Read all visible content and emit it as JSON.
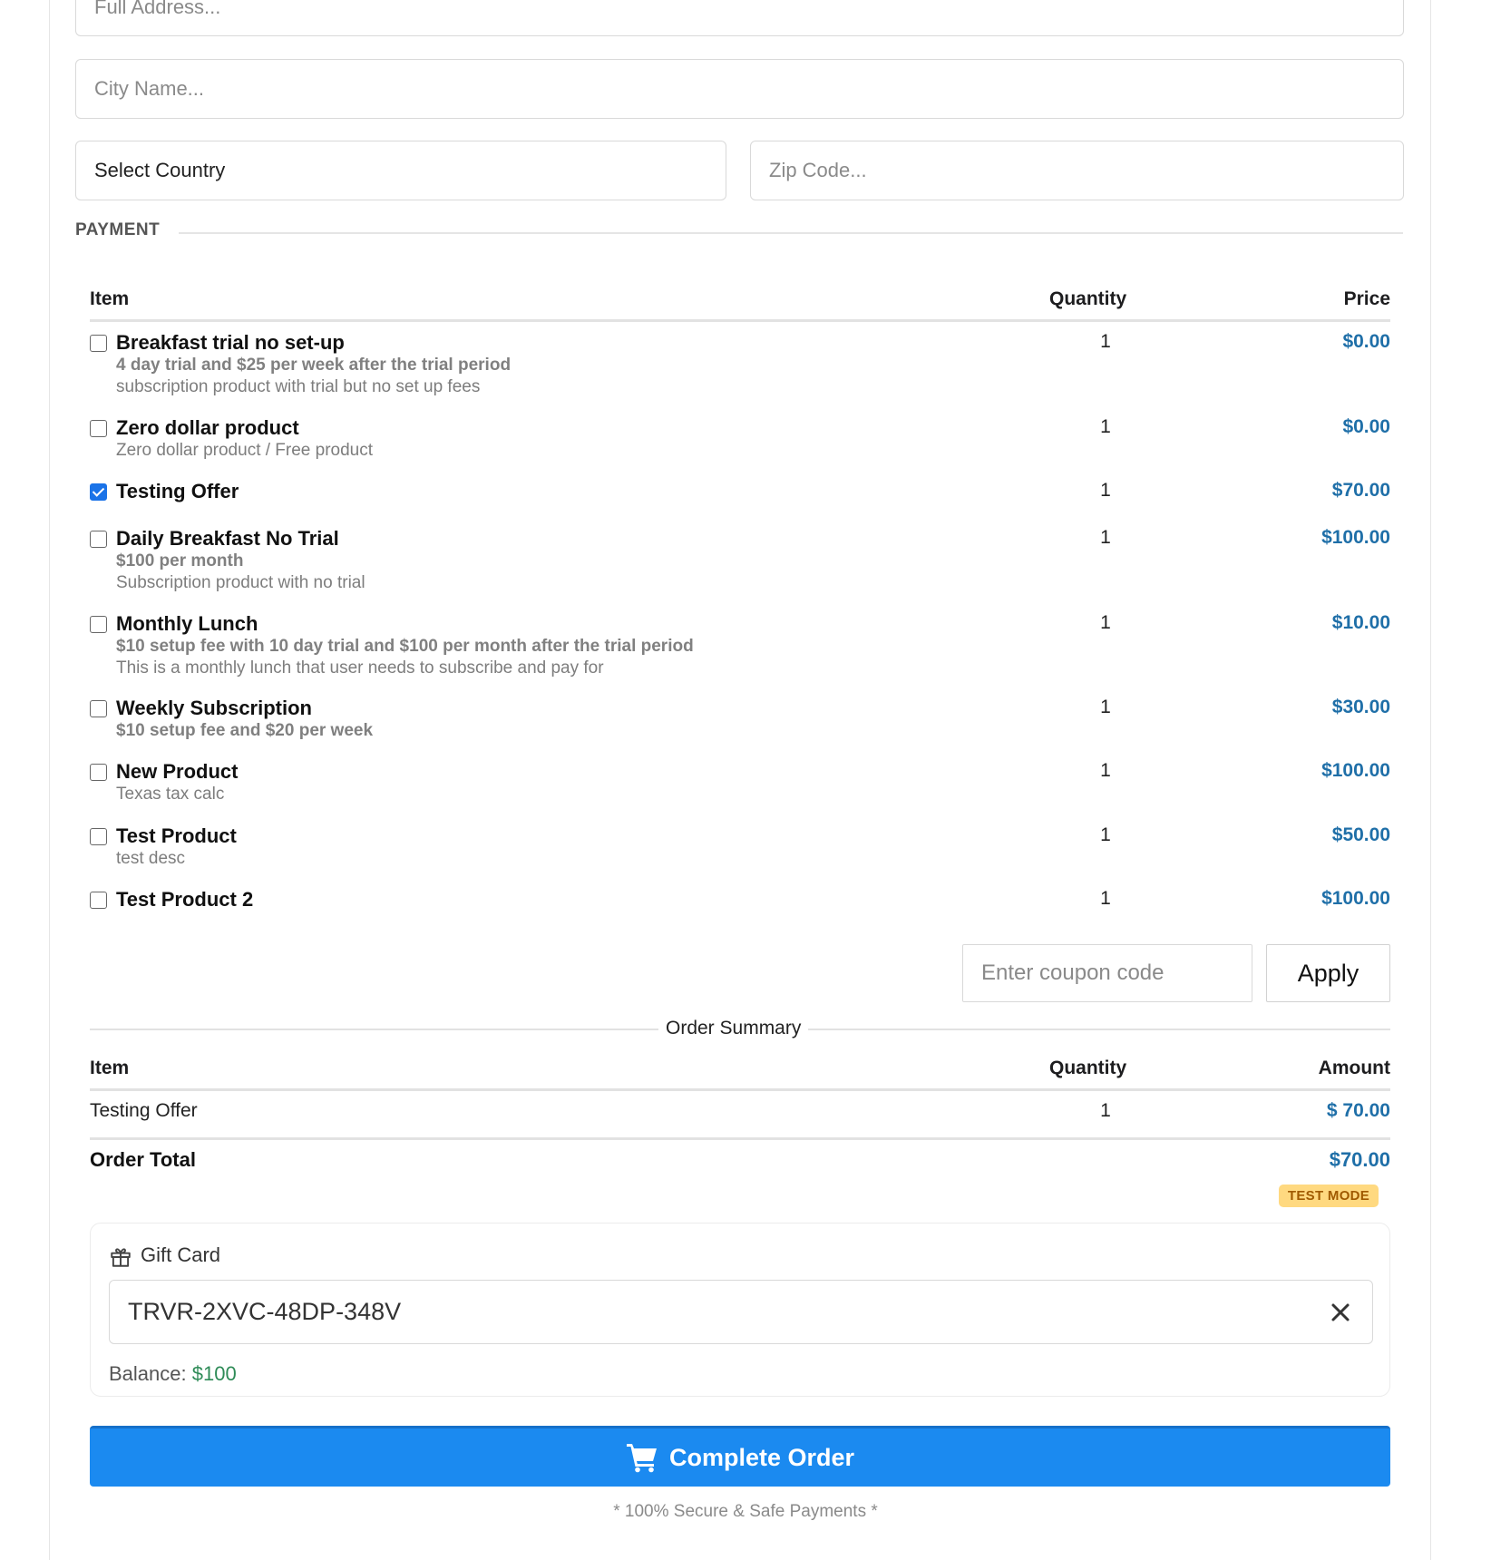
{
  "address": {
    "full_address_placeholder": "Full Address...",
    "city_placeholder": "City Name...",
    "country_value": "Select Country",
    "zip_placeholder": "Zip Code..."
  },
  "payment": {
    "section_title": "PAYMENT",
    "headers": {
      "item": "Item",
      "quantity": "Quantity",
      "price": "Price"
    },
    "products": [
      {
        "name": "Breakfast trial no set-up",
        "highlight": "4 day trial and $25 per week after the trial period",
        "description": "subscription product with trial but no set up fees",
        "qty": "1",
        "price": "$0.00",
        "checked": false
      },
      {
        "name": "Zero dollar product",
        "highlight": "",
        "description": "Zero dollar product / Free product",
        "qty": "1",
        "price": "$0.00",
        "checked": false
      },
      {
        "name": "Testing Offer",
        "highlight": "",
        "description": "",
        "qty": "1",
        "price": "$70.00",
        "checked": true
      },
      {
        "name": "Daily Breakfast No Trial",
        "highlight": "$100 per month",
        "description": "Subscription product with no trial",
        "qty": "1",
        "price": "$100.00",
        "checked": false
      },
      {
        "name": "Monthly Lunch",
        "highlight": "$10 setup fee with 10 day trial and $100 per month after the trial period",
        "description": "This is a monthly lunch that user needs to subscribe and pay for",
        "qty": "1",
        "price": "$10.00",
        "checked": false
      },
      {
        "name": "Weekly Subscription",
        "highlight": "$10 setup fee and $20 per week",
        "description": "",
        "qty": "1",
        "price": "$30.00",
        "checked": false
      },
      {
        "name": "New Product",
        "highlight": "",
        "description": "Texas tax calc",
        "qty": "1",
        "price": "$100.00",
        "checked": false
      },
      {
        "name": "Test Product",
        "highlight": "",
        "description": "test desc",
        "qty": "1",
        "price": "$50.00",
        "checked": false
      },
      {
        "name": "Test Product 2",
        "highlight": "",
        "description": "",
        "qty": "1",
        "price": "$100.00",
        "checked": false
      }
    ],
    "coupon_placeholder": "Enter coupon code",
    "apply_label": "Apply"
  },
  "summary": {
    "title": "Order Summary",
    "headers": {
      "item": "Item",
      "quantity": "Quantity",
      "amount": "Amount"
    },
    "rows": [
      {
        "item": "Testing Offer",
        "qty": "1",
        "amount": "$ 70.00"
      }
    ],
    "total_label": "Order Total",
    "total_value": "$70.00",
    "test_mode_badge": "TEST MODE"
  },
  "gift_card": {
    "label": "Gift Card",
    "code": "TRVR-2XVC-48DP-348V",
    "balance_label": "Balance:",
    "balance_value": "$100",
    "icon": "gift-icon"
  },
  "checkout": {
    "complete_label": "Complete Order",
    "icon": "cart-icon",
    "secure_note": "* 100% Secure & Safe Payments *"
  },
  "colors": {
    "price": "#1f6fa8",
    "primary_button": "#1b8af0",
    "checkbox_checked": "#1a73e8",
    "balance": "#2e8b57",
    "badge_bg": "#ffd980"
  }
}
